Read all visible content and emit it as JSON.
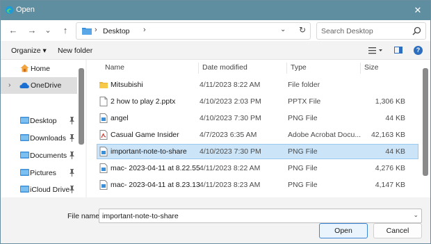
{
  "window": {
    "title": "Open",
    "close_label": "✕"
  },
  "nav": {
    "back_label": "←",
    "forward_label": "→",
    "recent_label": "⌄",
    "up_label": "↑",
    "path_separator": "›",
    "path_crumb": "Desktop",
    "address_dropdown": "⌄",
    "refresh_label": "↻",
    "search_placeholder": "Search Desktop"
  },
  "toolbar": {
    "organize_label": "Organize ▾",
    "new_folder_label": "New folder",
    "help_label": "?"
  },
  "sidebar": {
    "items": [
      {
        "label": "Home",
        "icon": "home-icon",
        "pinned": false
      },
      {
        "label": "OneDrive",
        "icon": "cloud-icon",
        "pinned": false
      },
      {
        "label": "Desktop",
        "icon": "folder-icon",
        "pinned": true
      },
      {
        "label": "Downloads",
        "icon": "folder-icon",
        "pinned": true
      },
      {
        "label": "Documents",
        "icon": "folder-icon",
        "pinned": true
      },
      {
        "label": "Pictures",
        "icon": "folder-icon",
        "pinned": true
      },
      {
        "label": "iCloud Drive",
        "icon": "folder-icon",
        "pinned": true
      }
    ],
    "expand_glyph": "›"
  },
  "filelist": {
    "columns": {
      "name": "Name",
      "date": "Date modified",
      "type": "Type",
      "size": "Size"
    },
    "rows": [
      {
        "name": "Mitsubishi",
        "date": "4/11/2023 8:22 AM",
        "type": "File folder",
        "size": "",
        "icon": "folder-icon"
      },
      {
        "name": "2 how to play 2.pptx",
        "date": "4/10/2023 2:03 PM",
        "type": "PPTX File",
        "size": "1,306 KB",
        "icon": "document-icon"
      },
      {
        "name": "angel",
        "date": "4/10/2023 7:30 PM",
        "type": "PNG File",
        "size": "44 KB",
        "icon": "image-file-icon"
      },
      {
        "name": "Casual Game Insider",
        "date": "4/7/2023 6:35 AM",
        "type": "Adobe Acrobat Docu...",
        "size": "42,163 KB",
        "icon": "pdf-icon"
      },
      {
        "name": "important-note-to-share",
        "date": "4/10/2023 7:30 PM",
        "type": "PNG File",
        "size": "44 KB",
        "icon": "image-file-icon"
      },
      {
        "name": "mac- 2023-04-11 at 8.22.55 ...",
        "date": "4/11/2023 8:22 AM",
        "type": "PNG File",
        "size": "4,276 KB",
        "icon": "image-file-icon"
      },
      {
        "name": "mac- 2023-04-11 at 8.23.13 ...",
        "date": "4/11/2023 8:23 AM",
        "type": "PNG File",
        "size": "4,147 KB",
        "icon": "image-file-icon"
      }
    ],
    "selected_row_index": 4
  },
  "footer": {
    "file_name_label": "File name:",
    "file_name_value": "important-note-to-share",
    "open_label": "Open",
    "cancel_label": "Cancel"
  },
  "colors": {
    "titlebar": "#5f8ea1",
    "selection": "#cce4f7",
    "folder": "#f7c948",
    "accent": "#2d6fbe"
  }
}
